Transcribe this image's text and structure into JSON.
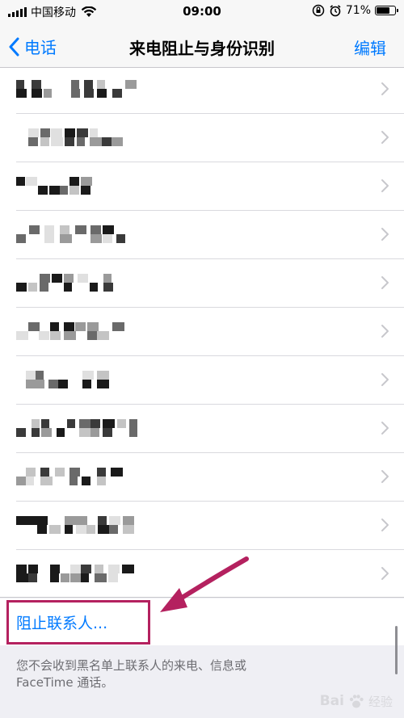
{
  "status_bar": {
    "carrier": "中国移动",
    "time": "09:00",
    "battery_percent": "71%",
    "battery_level": 0.71,
    "icons": [
      "signal-icon",
      "wifi-icon",
      "orientation-lock-icon",
      "alarm-icon",
      "battery-icon"
    ]
  },
  "nav": {
    "back_label": "电话",
    "title": "来电阻止与身份识别",
    "edit_label": "编辑"
  },
  "blocked_contacts_count": 11,
  "block_contact": {
    "label": "阻止联系人..."
  },
  "footer": {
    "line1": "您不会收到黑名单上联系人的来电、信息或",
    "line2": "FaceTime 通话。"
  },
  "watermark": {
    "brand": "Bai",
    "suffix": "经验",
    "icon": "baidu-paw-icon"
  },
  "colors": {
    "accent": "#007aff",
    "highlight": "#b4215f",
    "background": "#efeff4"
  }
}
